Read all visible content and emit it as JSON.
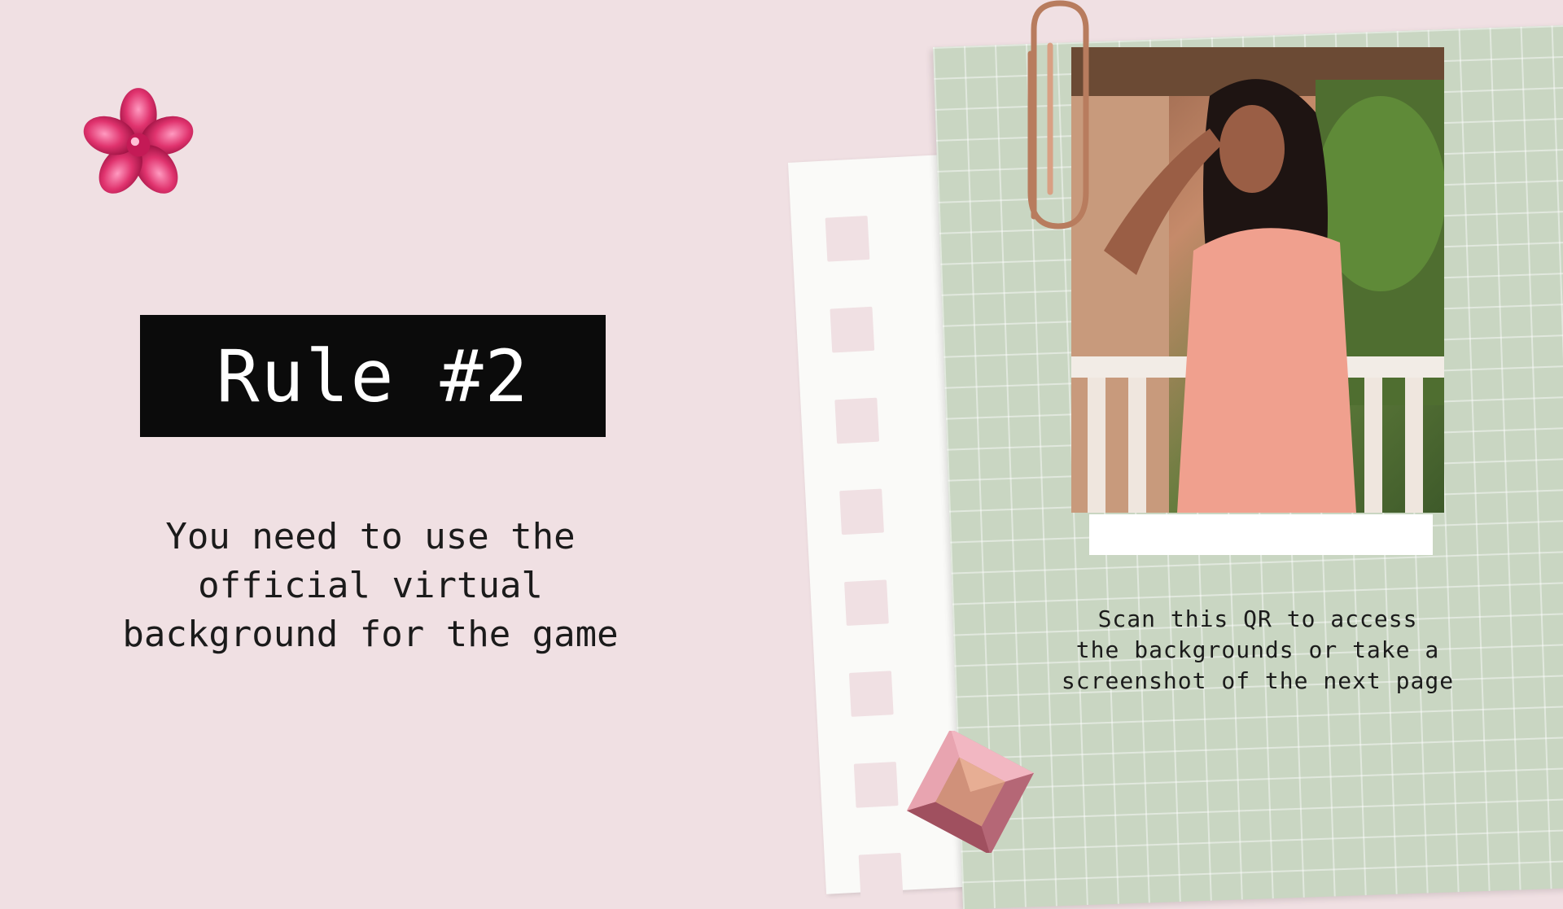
{
  "slide": {
    "title": "Rule #2",
    "rule_text": "You need to use the\nofficial virtual\nbackground for the game",
    "scan_text": "Scan this QR to access\nthe backgrounds or take a\nscreenshot of the next page"
  },
  "decorations": {
    "flower_icon": "pink-crystal-flower",
    "gem_icon": "square-pink-gem",
    "clip_icon": "copper-paperclip"
  },
  "colors": {
    "background": "#f0e0e3",
    "title_bg": "#0b0b0b",
    "grid_paper": "#c9d6c2",
    "accent_pink": "#e0336e"
  }
}
